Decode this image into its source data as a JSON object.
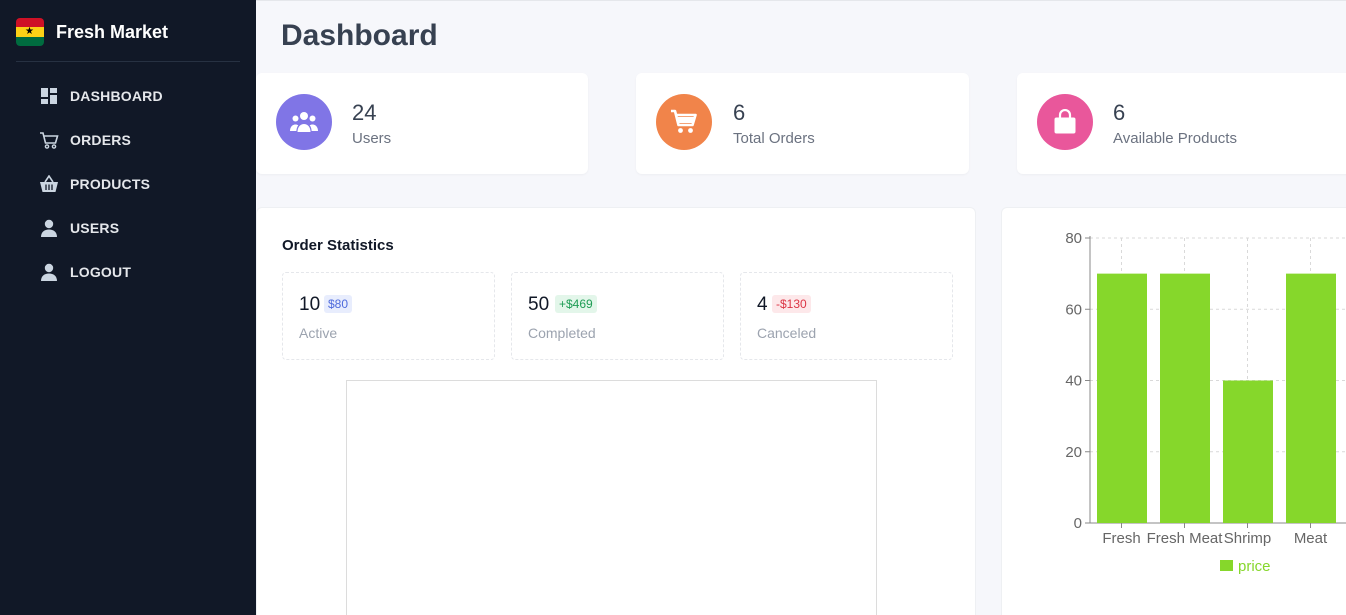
{
  "app": {
    "name": "Fresh Market",
    "flag_star": "★"
  },
  "sidebar": {
    "items": [
      {
        "label": "DASHBOARD",
        "icon": "dashboard-icon"
      },
      {
        "label": "ORDERS",
        "icon": "cart-outline-icon"
      },
      {
        "label": "PRODUCTS",
        "icon": "basket-icon"
      },
      {
        "label": "USERS",
        "icon": "user-icon"
      },
      {
        "label": "LOGOUT",
        "icon": "user-icon"
      }
    ]
  },
  "page": {
    "title": "Dashboard"
  },
  "stats": [
    {
      "value": "24",
      "label": "Users",
      "icon": "users-group-icon",
      "color": "#8075e6"
    },
    {
      "value": "6",
      "label": "Total Orders",
      "icon": "cart-icon",
      "color": "#f1844a"
    },
    {
      "value": "6",
      "label": "Available Products",
      "icon": "shopping-bag-icon",
      "color": "#e9579b"
    }
  ],
  "order_statistics": {
    "title": "Order Statistics",
    "cards": [
      {
        "value": "10",
        "badge": "$80",
        "label": "Active",
        "badge_color": "#4f6bdc",
        "badge_bg": "#e8edfd"
      },
      {
        "value": "50",
        "badge": "+$469",
        "label": "Completed",
        "badge_color": "#1f9d55",
        "badge_bg": "#e3f6ea"
      },
      {
        "value": "4",
        "badge": "-$130",
        "label": "Canceled",
        "badge_color": "#dc3545",
        "badge_bg": "#fde8ea"
      }
    ]
  },
  "chart_data": {
    "type": "bar",
    "categories": [
      "Fresh",
      "Fresh Meat",
      "Shrimp",
      "Meat"
    ],
    "series": [
      {
        "name": "price",
        "values": [
          70,
          70,
          40,
          70
        ]
      }
    ],
    "ylim": [
      0,
      80
    ],
    "yticks": [
      0,
      20,
      40,
      60,
      80
    ],
    "grid": true,
    "legend": "bottom",
    "color": "#86d72b"
  }
}
